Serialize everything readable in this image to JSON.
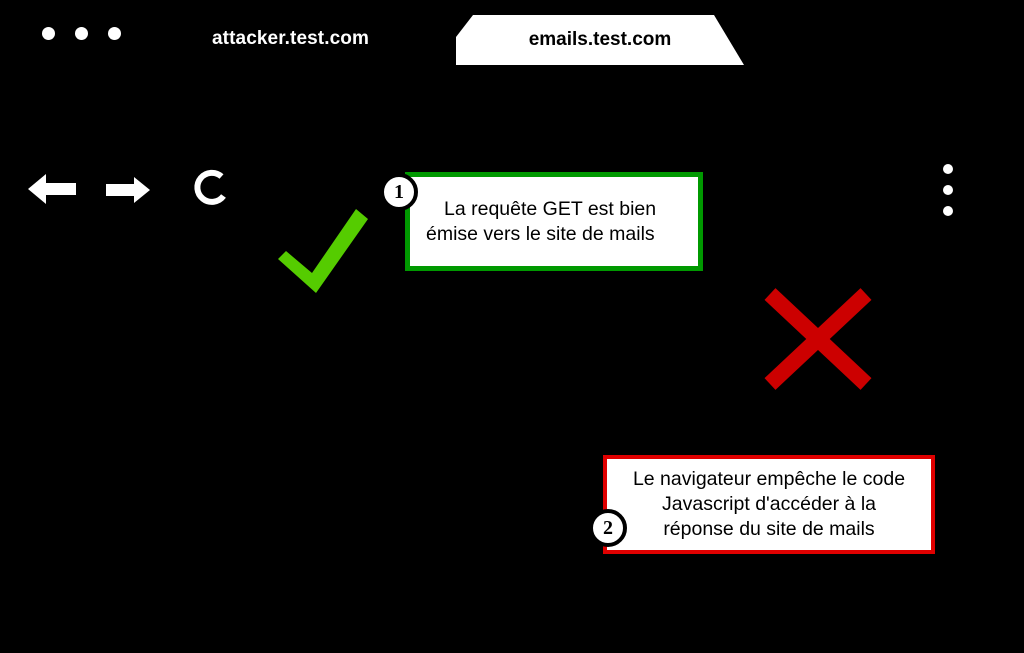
{
  "window": {
    "traffic_dots": [
      "dot-1",
      "dot-2",
      "dot-3"
    ]
  },
  "tabs": [
    {
      "label": "attacker.test.com",
      "active": false,
      "name": "tab-attacker"
    },
    {
      "label": "emails.test.com",
      "active": true,
      "name": "tab-emails"
    }
  ],
  "toolbar": {
    "back_icon": "back-arrow-icon",
    "forward_icon": "forward-arrow-icon",
    "reload_icon": "reload-icon",
    "menu_icon": "overflow-menu-icon"
  },
  "annotations": {
    "check_mark": {
      "icon": "check-mark-icon",
      "color": "#55CC00"
    },
    "cross_mark": {
      "icon": "cross-mark-icon",
      "color": "#CC0000"
    },
    "callouts": [
      {
        "badge": "1",
        "border_color": "#009900",
        "lines": [
          "La requête GET est bien",
          "émise vers le site de mails"
        ]
      },
      {
        "badge": "2",
        "border_color": "#E00000",
        "lines": [
          "Le navigateur empêche le code",
          "Javascript d'accéder à la",
          "réponse du site de mails"
        ]
      }
    ]
  },
  "page": {
    "background_color": "#000000"
  }
}
